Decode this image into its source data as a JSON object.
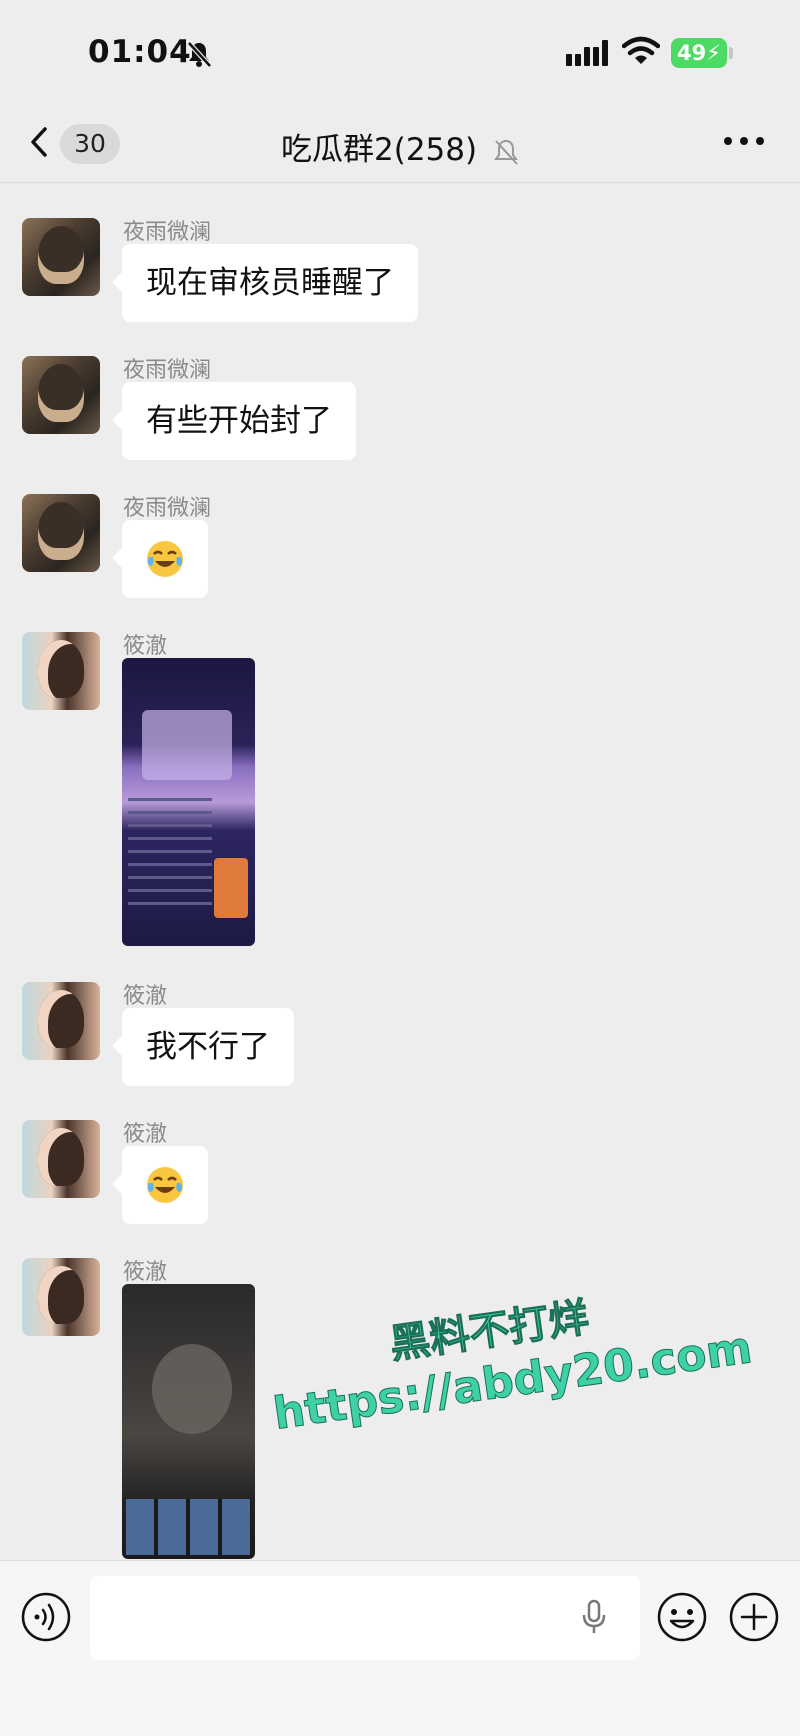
{
  "status_bar": {
    "time": "01:04",
    "battery": "49"
  },
  "nav": {
    "back_count": "30",
    "title": "吃瓜群2(258)"
  },
  "messages": [
    {
      "sender": "夜雨微澜",
      "text": "现在审核员睡醒了"
    },
    {
      "sender": "夜雨微澜",
      "text": "有些开始封了"
    },
    {
      "sender": "夜雨微澜",
      "emoji": "crying-laughing-emoji"
    },
    {
      "sender": "筱澈",
      "image": "screenshot"
    },
    {
      "sender": "筱澈",
      "text": "我不行了"
    },
    {
      "sender": "筱澈",
      "emoji": "crying-laughing-emoji"
    },
    {
      "sender": "筱澈",
      "image": "screenshot"
    }
  ],
  "watermark": {
    "line1": "黑料不打烊",
    "line2": "https://abdy20.com"
  },
  "input_bar": {
    "placeholder": ""
  },
  "colors": {
    "background": "#ededed",
    "bubble": "#ffffff",
    "battery": "#4cd964",
    "watermark": "#3fd1a6"
  }
}
